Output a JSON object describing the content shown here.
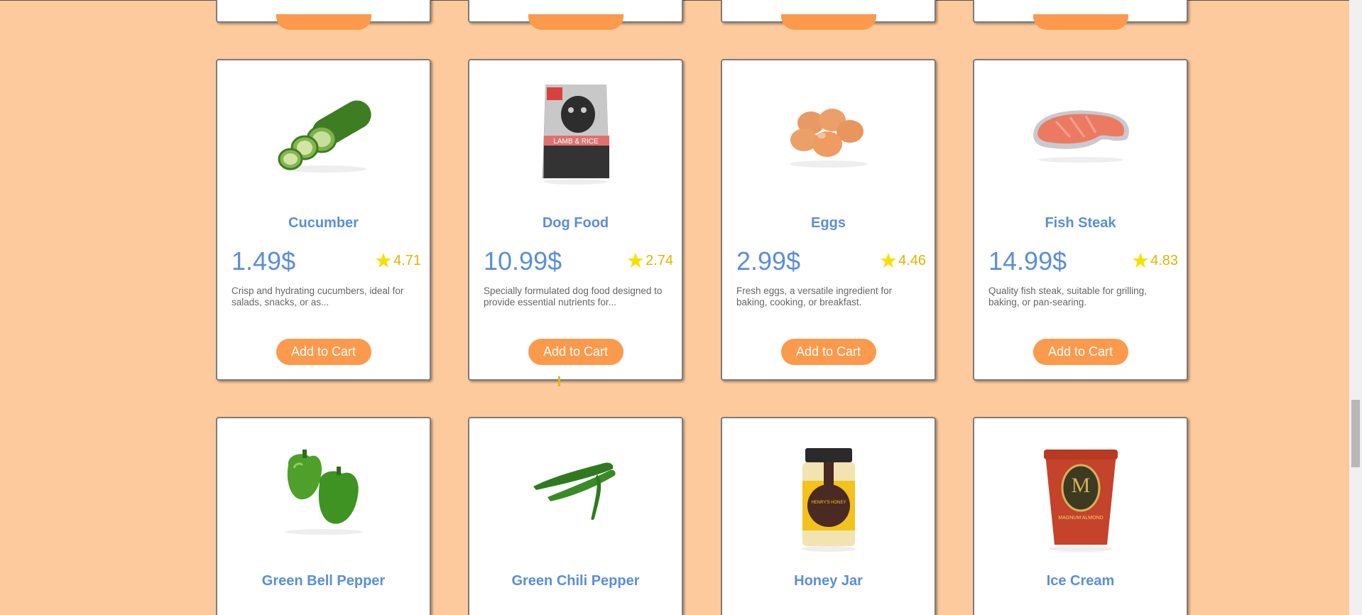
{
  "products": [
    {
      "name": "Cucumber",
      "price": "1.49$",
      "rating": "4.71",
      "description": "Crisp and hydrating cucumbers, ideal for salads, snacks, or as...",
      "button": "Add to Cart",
      "image_icon": "cucumber-image"
    },
    {
      "name": "Dog Food",
      "price": "10.99$",
      "rating": "2.74",
      "description": "Specially formulated dog food designed to provide essential nutrients for...",
      "button": "Add to Cart",
      "image_icon": "dog-food-bag-image",
      "image_text": "LAMB & RICE"
    },
    {
      "name": "Eggs",
      "price": "2.99$",
      "rating": "4.46",
      "description": "Fresh eggs, a versatile ingredient for baking, cooking, or breakfast.",
      "button": "Add to Cart",
      "image_icon": "eggs-image"
    },
    {
      "name": "Fish Steak",
      "price": "14.99$",
      "rating": "4.83",
      "description": "Quality fish steak, suitable for grilling, baking, or pan-searing.",
      "button": "Add to Cart",
      "image_icon": "fish-steak-image"
    },
    {
      "name": "Green Bell Pepper",
      "image_icon": "green-bell-pepper-image"
    },
    {
      "name": "Green Chili Pepper",
      "image_icon": "green-chili-pepper-image"
    },
    {
      "name": "Honey Jar",
      "image_icon": "honey-jar-image",
      "image_text": "HENRY'S HONEY"
    },
    {
      "name": "Ice Cream",
      "image_icon": "ice-cream-tub-image",
      "image_text": "MAGNUM ALMOND"
    }
  ],
  "colors": {
    "background": "#fdca9d",
    "accent": "#fb9a4d",
    "title": "#5b8ed9",
    "rating": "#e0b400",
    "star": "#f5e000"
  },
  "icons": {
    "star": "star-icon"
  }
}
